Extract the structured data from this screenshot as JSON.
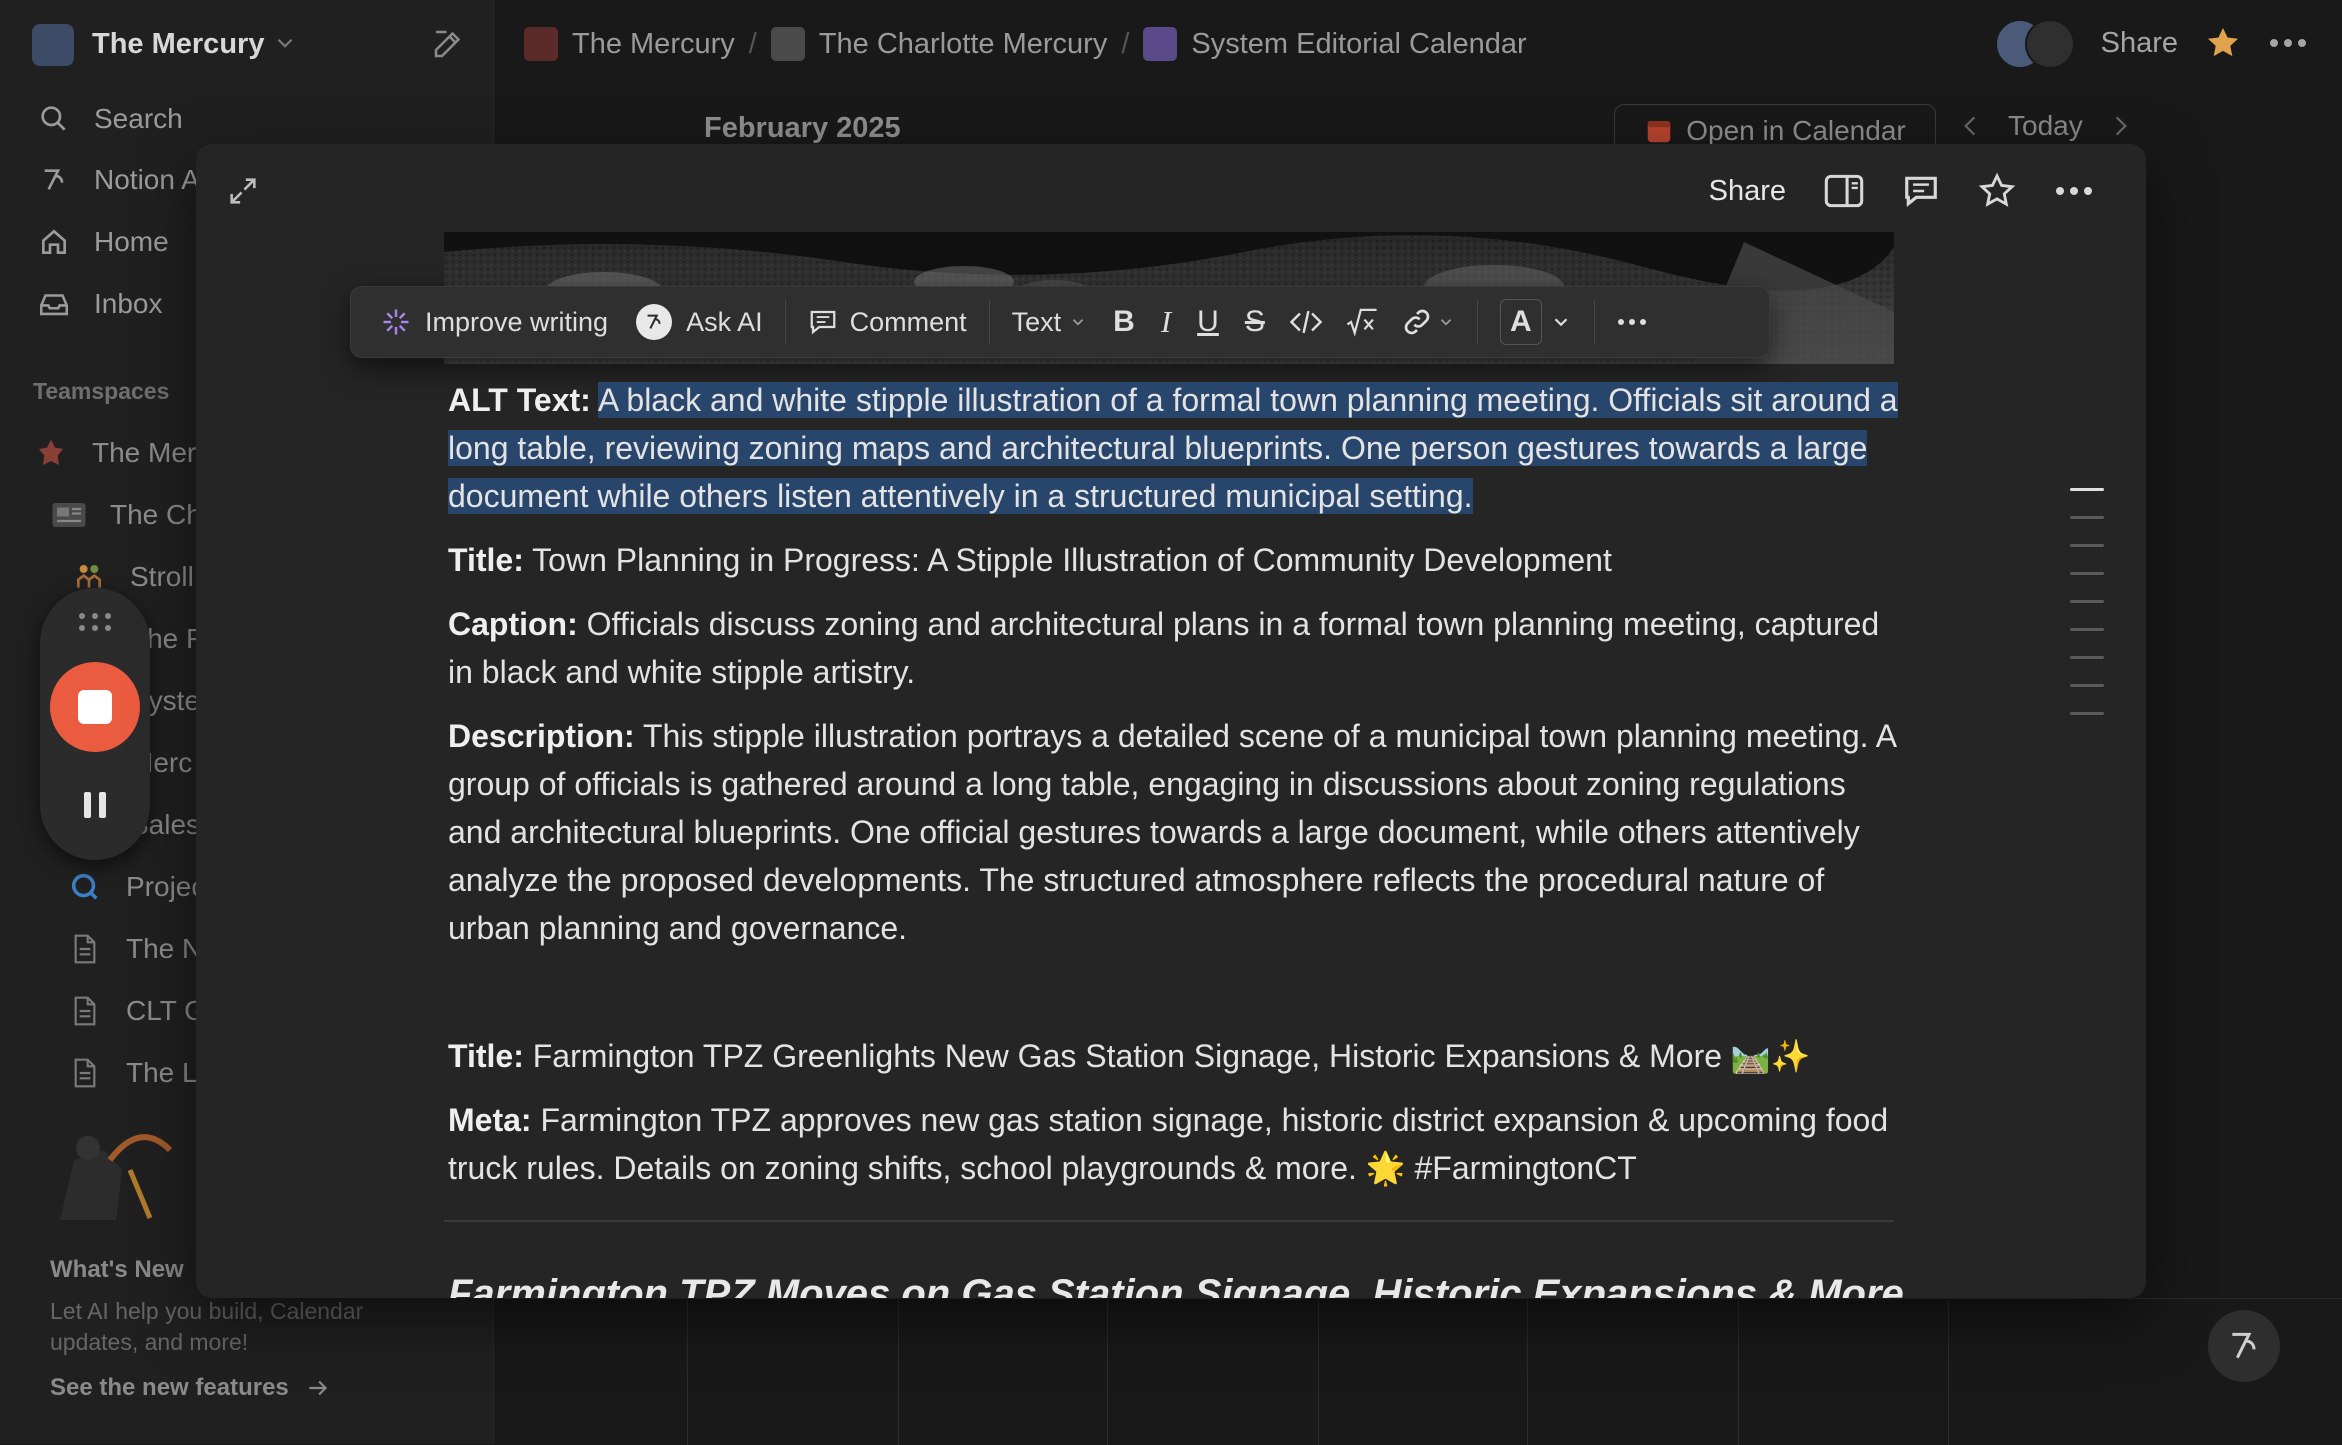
{
  "workspace": {
    "name": "The Mercury"
  },
  "sidebar": {
    "nav": [
      {
        "label": "Search",
        "icon": "search-icon"
      },
      {
        "label": "Notion AI",
        "icon": "notion-ai-icon"
      },
      {
        "label": "Home",
        "icon": "home-icon"
      },
      {
        "label": "Inbox",
        "icon": "inbox-icon"
      }
    ],
    "section_label": "Teamspaces",
    "pages": [
      {
        "label": "The Mercury",
        "indent": 0
      },
      {
        "label": "The Charlotte Mercury",
        "indent": 1
      },
      {
        "label": "Stroll",
        "indent": 2
      },
      {
        "label": "The F",
        "indent": 2
      },
      {
        "label": "System",
        "indent": 2
      },
      {
        "label": "Merc",
        "indent": 2
      },
      {
        "label": "Sales",
        "indent": 2
      },
      {
        "label": "Projects",
        "indent": 1
      },
      {
        "label": "The N",
        "indent": 1
      },
      {
        "label": "CLT G",
        "indent": 1
      },
      {
        "label": "The L",
        "indent": 1
      }
    ],
    "whats_new": {
      "title": "What's New",
      "body": "Let AI help you build, Calendar updates, and more!",
      "link": "See the new features"
    }
  },
  "breadcrumb": {
    "items": [
      "The Mercury",
      "The Charlotte Mercury",
      "System Editorial Calendar"
    ],
    "separator": "/"
  },
  "topbar": {
    "share_label": "Share"
  },
  "calendar": {
    "month": "February 2025",
    "open_label": "Open in Calendar",
    "today_label": "Today"
  },
  "modal": {
    "share_label": "Share",
    "toolbar": {
      "improve_writing": "Improve writing",
      "ask_ai": "Ask AI",
      "comment": "Comment",
      "text_type": "Text",
      "text_color_letter": "A"
    },
    "blocks": {
      "alt_label": "ALT Text:",
      "alt_text": "A black and white stipple illustration of a formal town planning meeting. Officials sit around a long table, reviewing zoning maps and architectural blueprints. One person gestures towards a large document while others listen attentively in a structured municipal setting.",
      "title_label": "Title:",
      "title_text": "Town Planning in Progress: A Stipple Illustration of Community Development",
      "caption_label": "Caption:",
      "caption_text": "Officials discuss zoning and architectural plans in a formal town planning meeting, captured in black and white stipple artistry.",
      "description_label": "Description:",
      "description_text": "This stipple illustration portrays a detailed scene of a municipal town planning meeting. A group of officials is gathered around a long table, engaging in discussions about zoning regulations and architectural blueprints. One official gestures towards a large document, while others attentively analyze the proposed developments. The structured atmosphere reflects the procedural nature of urban planning and governance.",
      "title2_label": "Title:",
      "title2_text": "Farmington TPZ Greenlights New Gas Station Signage, Historic Expansions & More 🛤️✨",
      "meta_label": "Meta:",
      "meta_text": "Farmington TPZ approves new gas station signage, historic district expansion & upcoming food truck rules. Details on zoning shifts, school playgrounds & more. 🌟 #FarmingtonCT",
      "heading_cut": "Farmington TPZ Moves on Gas Station Signage, Historic Expansions & More"
    }
  },
  "colors": {
    "background": "#191919",
    "sidebar": "#202020",
    "modal": "#252525",
    "selection": "#28456c",
    "record": "#eb5b3f"
  }
}
